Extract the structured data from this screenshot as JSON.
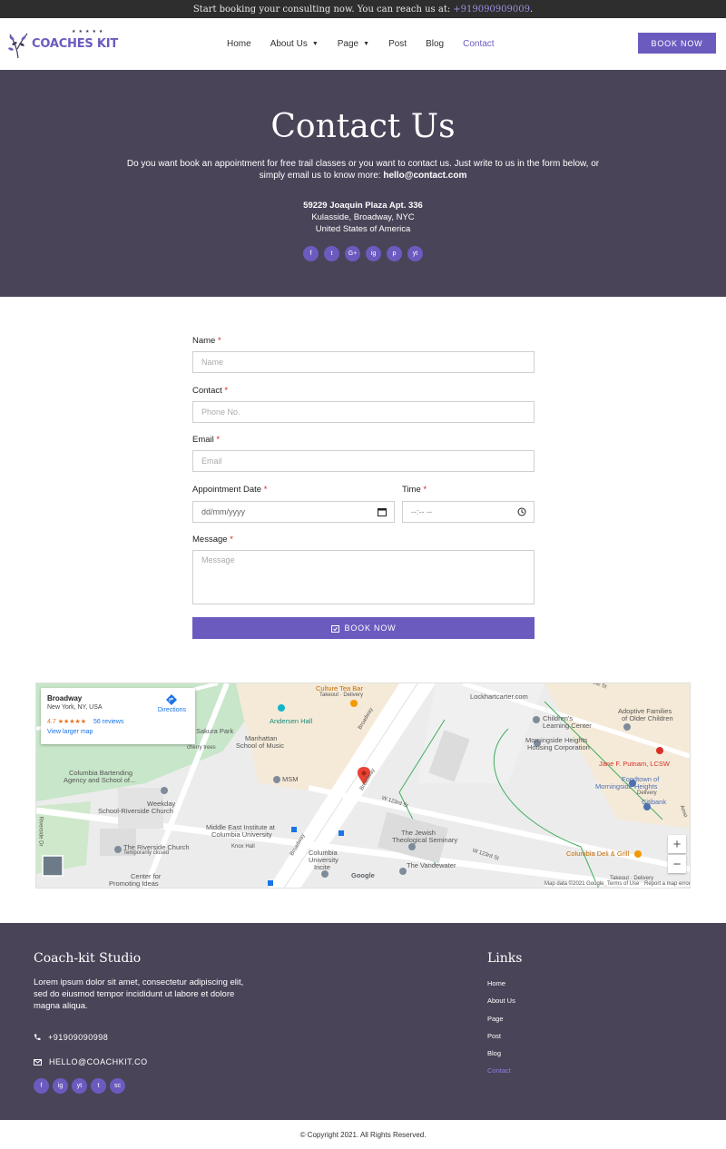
{
  "topbar": {
    "text": "Start booking your consulting now. You can reach us at:",
    "phone": "+919090909009",
    "period": "."
  },
  "brand": {
    "name": "COACHES KIT"
  },
  "nav": {
    "items": [
      {
        "label": "Home"
      },
      {
        "label": "About Us"
      },
      {
        "label": "Page"
      },
      {
        "label": "Post"
      },
      {
        "label": "Blog"
      },
      {
        "label": "Contact"
      }
    ],
    "cta": "BOOK NOW"
  },
  "hero": {
    "title": "Contact Us",
    "lead": "Do you want book an appointment for free trail classes or you want to contact us. Just write to us in the form below, or simply email us to know more:",
    "email": "hello@contact.com",
    "address_line1": "59229 Joaquin Plaza Apt. 336",
    "address_line2": "Kulasside, Broadway, NYC",
    "address_line3": "United States of America",
    "social": [
      "f",
      "t",
      "G+",
      "ig",
      "p",
      "yt"
    ]
  },
  "form": {
    "name_label": "Name",
    "name_placeholder": "Name",
    "contact_label": "Contact",
    "contact_placeholder": "Phone No.",
    "email_label": "Email",
    "email_placeholder": "Email",
    "date_label": "Appointment Date",
    "date_placeholder": "dd/mm/yyyy",
    "time_label": "Time",
    "time_placeholder": "--:-- --",
    "message_label": "Message",
    "message_placeholder": "Message",
    "submit": "BOOK NOW",
    "required": "*"
  },
  "map": {
    "card_title": "Broadway",
    "card_address": "New York, NY, USA",
    "rating": "4.7",
    "stars": "★★★★★",
    "reviews": "56 reviews",
    "directions": "Directions",
    "larger": "View larger map",
    "labels": {
      "culture": "Culture Tea Bar",
      "culture_sub": "Takeout · Delivery",
      "lockhart": "Lockhartcarter.com",
      "adoptive": "Adoptive Families",
      "adoptive2": "of Older Children",
      "childrens": "Children's",
      "childrens2": "Learning Center",
      "morningside": "Morningside Heights",
      "morningside2": "Housing Corporation",
      "jane": "Jane F. Putnam, LCSW",
      "foodtown": "Foodtown of",
      "foodtown2": "Morningside Heights",
      "foodtown3": "Delivery",
      "citibank": "Citibank",
      "andersen": "Andersen Hall",
      "manhattan": "Manhattan",
      "manhattan2": "School of Music",
      "msm": "MSM",
      "sakura": "Sakura Park",
      "cherry": "cherry trees",
      "bartending": "Columbia Bartending",
      "bartending2": "Agency and School of...",
      "weekday": "Weekday",
      "riverside": "School-Riverside Church",
      "middle": "Middle East Institute at",
      "middle2": "Columbia University",
      "knox": "Knox Hall",
      "riverside_church": "The Riverside Church",
      "temp_closed": "Temporarily closed",
      "center": "Center for",
      "center2": "Promoting Ideas",
      "jewish": "The Jewish",
      "jewish2": "Theological Seminary",
      "vandewater": "The Vandewater",
      "columbia_uni": "Columbia",
      "columbia_uni2": "University",
      "columbia_uni3": "Incite",
      "deli": "Columbia Deli & Grill",
      "deli2": "Takeout · Delivery",
      "broadway1": "Broadway",
      "broadway2": "Broadway",
      "broadway3": "Broadway",
      "w123": "W 123rd St",
      "w123b": "W 123rd St",
      "riverside_dr": "Riverside Dr",
      "sallest": "Salle St",
      "amst": "Amst",
      "google": "Google",
      "mapdata": "Map data ©2021 Google",
      "terms": "Terms of Use",
      "report": "Report a map error"
    }
  },
  "footer": {
    "studio_title": "Coach-kit Studio",
    "studio_text": "Lorem ipsum dolor sit amet, consectetur adipiscing elit, sed do eiusmod tempor incididunt ut labore et dolore magna aliqua.",
    "phone": "+91909090998",
    "email": "HELLO@COACHKIT.CO",
    "links_title": "Links",
    "links": [
      "Home",
      "About Us",
      "Page",
      "Post",
      "Blog",
      "Contact"
    ],
    "social": [
      "f",
      "ig",
      "yt",
      "t",
      "sc"
    ]
  },
  "copyright": "© Copyright 2021. All Rights Reserved.",
  "colors": {
    "accent": "#6c5bbf",
    "hero_bg": "#4a4458",
    "topbar_bg": "#2e2e2e",
    "required": "#d62020"
  }
}
